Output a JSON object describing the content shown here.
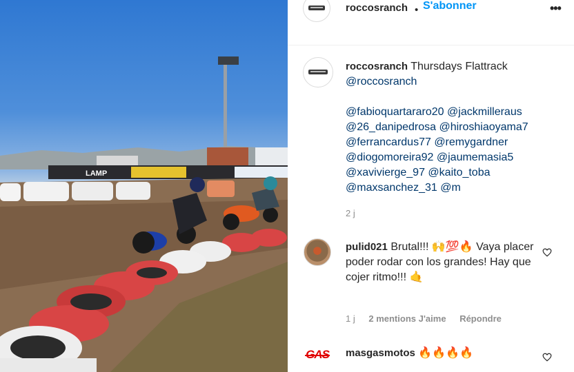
{
  "post": {
    "author": "roccosranch",
    "follow_separator": "•",
    "follow_label": "S'abonner",
    "more_label": "•••",
    "media_banner": "LAMP"
  },
  "caption": {
    "username": "roccosranch",
    "text": "Thursdays Flattrack",
    "mentions": [
      "@roccosranch",
      "@fabioquartararo20",
      "@jackmilleraus",
      "@26_danipedrosa",
      "@hiroshiaoyama7",
      "@ferrancardus77",
      "@remygardner",
      "@diogomoreira92",
      "@jaumemasia5",
      "@xavivierge_97",
      "@kaito_toba",
      "@maxsanchez_31",
      "@m"
    ],
    "time": "2 j"
  },
  "comments": [
    {
      "username": "pulid021",
      "text_start": "Brutal!!!",
      "emojis": "🙌💯🔥",
      "text_rest": "Vaya placer poder rodar con los grandes! Hay que cojer ritmo!!!",
      "emoji_end": "🤙",
      "time": "1 j",
      "likes": "2 mentions J'aime",
      "reply": "Répondre"
    },
    {
      "username": "masgasmotos",
      "emojis": "🔥🔥🔥🔥",
      "avatar_text": "GAS"
    }
  ],
  "colors": {
    "link": "#00376b",
    "follow": "#0095f6",
    "meta": "#8e8e8e"
  },
  "icons": [
    "heart-icon",
    "more-options-icon"
  ]
}
